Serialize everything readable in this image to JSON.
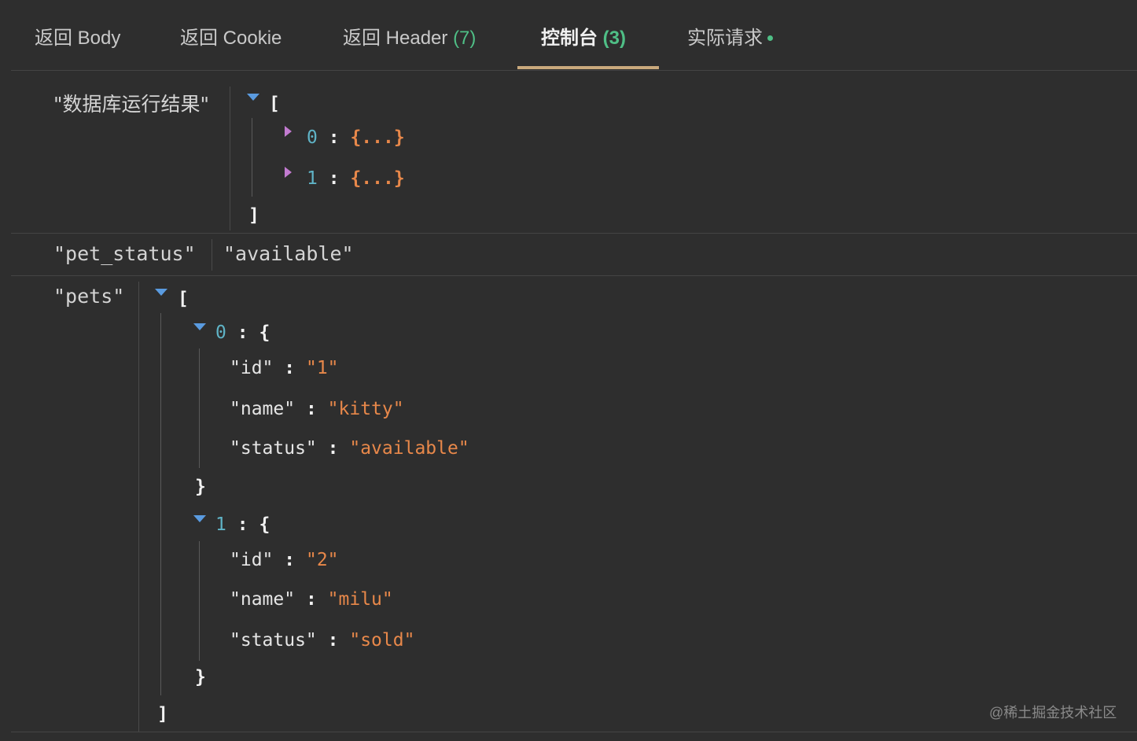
{
  "tabs": [
    {
      "label": "返回 Body",
      "count": ""
    },
    {
      "label": "返回 Cookie",
      "count": ""
    },
    {
      "label": "返回 Header",
      "count": "(7)"
    },
    {
      "label": "控制台",
      "count": "(3)"
    },
    {
      "label": "实际请求",
      "count": ""
    }
  ],
  "active_tab_index": 3,
  "colors": {
    "accent_underline": "#c9a97c",
    "count_green": "#4fbf86",
    "string_orange": "#e8884a",
    "index_teal": "#5fb3c6"
  },
  "rows": {
    "db": {
      "key": "\"数据库运行结果\"",
      "open": "[",
      "close": "]",
      "items": [
        {
          "index": "0",
          "colon": ":",
          "collapsed": "{...}"
        },
        {
          "index": "1",
          "colon": ":",
          "collapsed": "{...}"
        }
      ]
    },
    "pet_status": {
      "key": "\"pet_status\"",
      "value": "\"available\""
    },
    "pets": {
      "key": "\"pets\"",
      "open": "[",
      "close": "]",
      "items": [
        {
          "index": "0",
          "colon": ":",
          "open": "{",
          "close": "}",
          "fields": [
            {
              "key": "\"id\"",
              "colon": ":",
              "value": "\"1\""
            },
            {
              "key": "\"name\"",
              "colon": ":",
              "value": "\"kitty\""
            },
            {
              "key": "\"status\"",
              "colon": ":",
              "value": "\"available\""
            }
          ]
        },
        {
          "index": "1",
          "colon": ":",
          "open": "{",
          "close": "}",
          "fields": [
            {
              "key": "\"id\"",
              "colon": ":",
              "value": "\"2\""
            },
            {
              "key": "\"name\"",
              "colon": ":",
              "value": "\"milu\""
            },
            {
              "key": "\"status\"",
              "colon": ":",
              "value": "\"sold\""
            }
          ]
        }
      ]
    }
  },
  "watermark": "@稀土掘金技术社区"
}
